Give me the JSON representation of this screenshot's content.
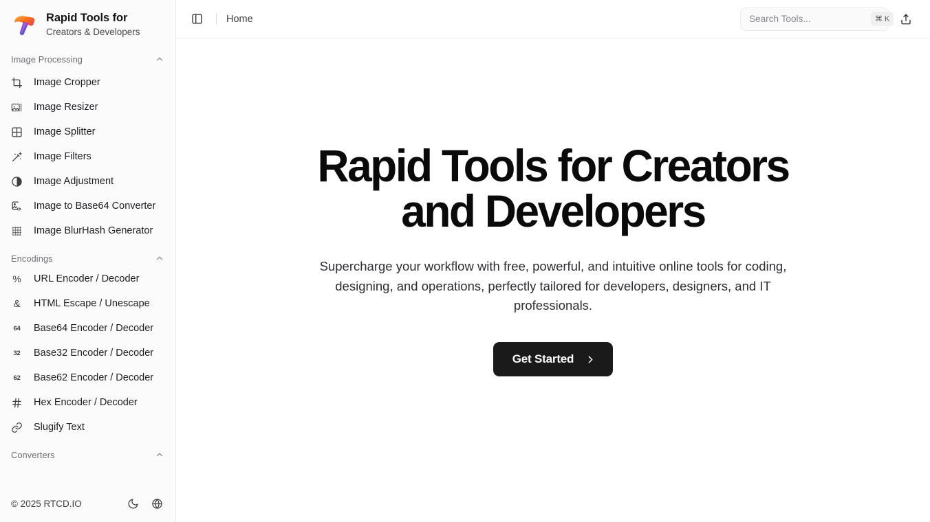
{
  "brand": {
    "logo_icon": "hammer-icon",
    "title": "Rapid Tools for",
    "subtitle": "Creators & Developers"
  },
  "sidebar": {
    "sections": [
      {
        "title": "Image Processing",
        "collapse_icon": "chevron-up-icon",
        "items": [
          {
            "label": "Image Cropper",
            "icon": "crop-icon"
          },
          {
            "label": "Image Resizer",
            "icon": "image-resize-icon"
          },
          {
            "label": "Image Splitter",
            "icon": "grid-split-icon"
          },
          {
            "label": "Image Filters",
            "icon": "magic-wand-icon"
          },
          {
            "label": "Image Adjustment",
            "icon": "contrast-icon"
          },
          {
            "label": "Image to Base64 Converter",
            "icon": "image-code-icon"
          },
          {
            "label": "Image BlurHash Generator",
            "icon": "blur-grid-icon"
          }
        ]
      },
      {
        "title": "Encodings",
        "collapse_icon": "chevron-up-icon",
        "items": [
          {
            "label": "URL Encoder / Decoder",
            "icon": "percent-icon",
            "glyph": "%"
          },
          {
            "label": "HTML Escape / Unescape",
            "icon": "ampersand-icon",
            "glyph": "&"
          },
          {
            "label": "Base64 Encoder / Decoder",
            "icon": "base64-icon",
            "glyph": "64"
          },
          {
            "label": "Base32 Encoder / Decoder",
            "icon": "base32-icon",
            "glyph": "32"
          },
          {
            "label": "Base62 Encoder / Decoder",
            "icon": "base62-icon",
            "glyph": "62"
          },
          {
            "label": "Hex Encoder / Decoder",
            "icon": "hash-icon",
            "glyph": "#"
          },
          {
            "label": "Slugify Text",
            "icon": "link-icon"
          }
        ]
      },
      {
        "title": "Converters",
        "collapse_icon": "chevron-up-icon",
        "items": []
      }
    ],
    "footer": {
      "copyright": "© 2025 RTCD.IO",
      "theme_toggle_icon": "moon-icon",
      "language_icon": "globe-icon"
    }
  },
  "topbar": {
    "sidebar_toggle_icon": "panel-left-icon",
    "breadcrumb": "Home",
    "search": {
      "placeholder": "Search Tools...",
      "value": "",
      "shortcut_modifier": "⌘",
      "shortcut_key": "K",
      "icon": "search-icon"
    },
    "share_icon": "share-upload-icon"
  },
  "hero": {
    "title": "Rapid Tools for Creators and Developers",
    "subtitle": "Supercharge your workflow with free, powerful, and intuitive online tools for coding, designing, and operations, perfectly tailored for developers, designers, and IT professionals.",
    "cta_label": "Get Started",
    "cta_icon": "chevron-right-icon"
  },
  "colors": {
    "sidebar_bg": "#fbfbfb",
    "main_bg": "#ffffff",
    "text_primary": "#0a0a0a",
    "text_secondary": "#6d6e74",
    "cta_bg": "#1a1a1a",
    "border": "#e8e8e8"
  }
}
